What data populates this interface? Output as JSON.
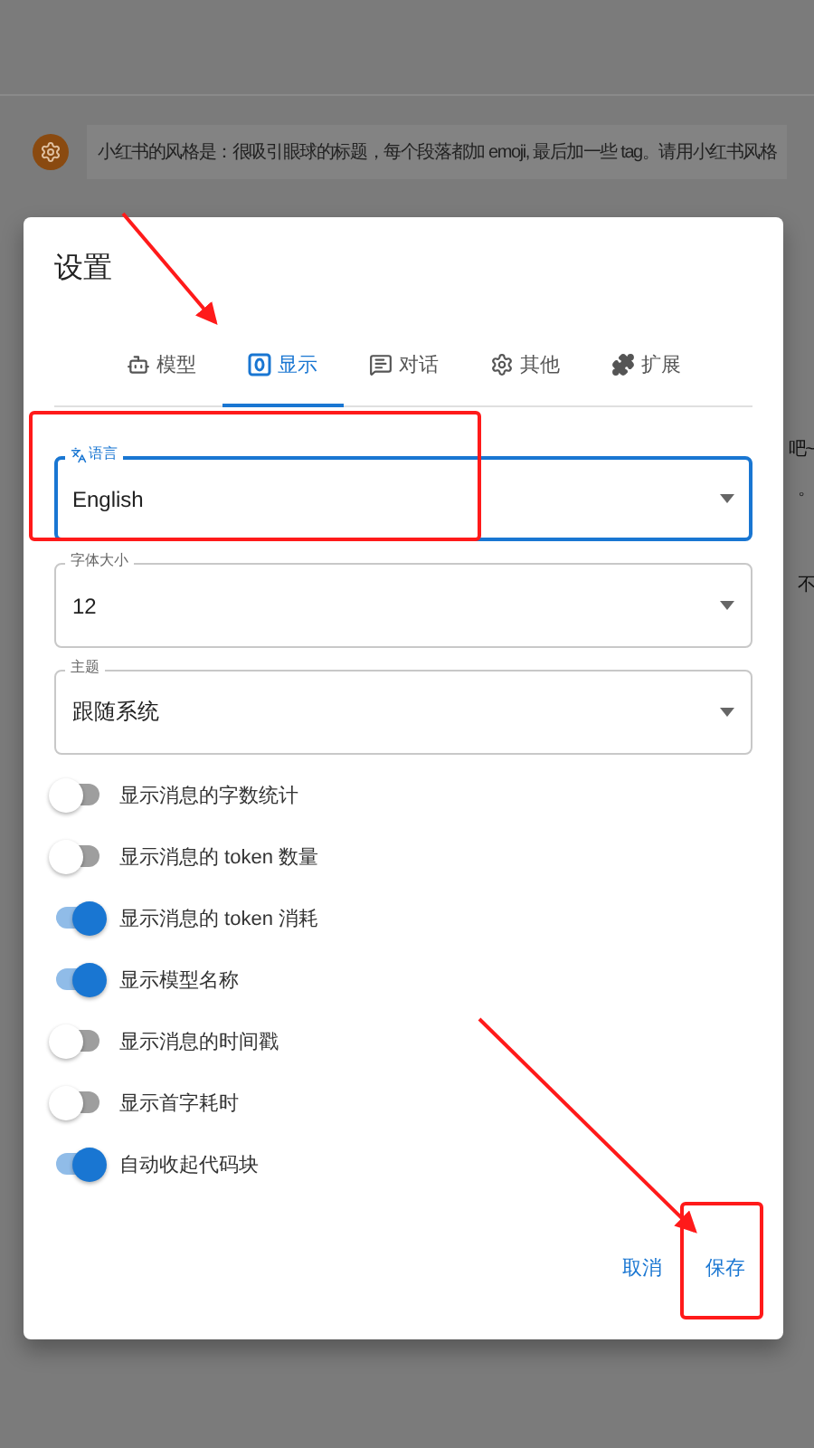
{
  "background": {
    "message": "小红书的风格是：很吸引眼球的标题，每个段落都加 emoji, 最后加一些 tag。请用小红书风格",
    "fragments": [
      "吧~",
      "。",
      "不"
    ]
  },
  "dialog": {
    "title": "设置",
    "tabs": [
      {
        "label": "模型",
        "kind": "robot",
        "selected": false
      },
      {
        "label": "显示",
        "kind": "display",
        "selected": true
      },
      {
        "label": "对话",
        "kind": "chat",
        "selected": false
      },
      {
        "label": "其他",
        "kind": "gear",
        "selected": false
      },
      {
        "label": "扩展",
        "kind": "puzzle",
        "selected": false
      }
    ],
    "selects": [
      {
        "label": "语言",
        "kind": "translate",
        "value": "English",
        "focused": true
      },
      {
        "label": "字体大小",
        "kind": "plain",
        "value": "12",
        "focused": false
      },
      {
        "label": "主题",
        "kind": "plain",
        "value": "跟随系统",
        "focused": false
      }
    ],
    "switches": [
      {
        "label": "显示消息的字数统计",
        "on": false
      },
      {
        "label": "显示消息的 token 数量",
        "on": false
      },
      {
        "label": "显示消息的 token 消耗",
        "on": true
      },
      {
        "label": "显示模型名称",
        "on": true
      },
      {
        "label": "显示消息的时间戳",
        "on": false
      },
      {
        "label": "显示首字耗时",
        "on": false
      },
      {
        "label": "自动收起代码块",
        "on": true
      }
    ],
    "buttons": [
      {
        "label": "取消"
      },
      {
        "label": "保存"
      }
    ]
  }
}
